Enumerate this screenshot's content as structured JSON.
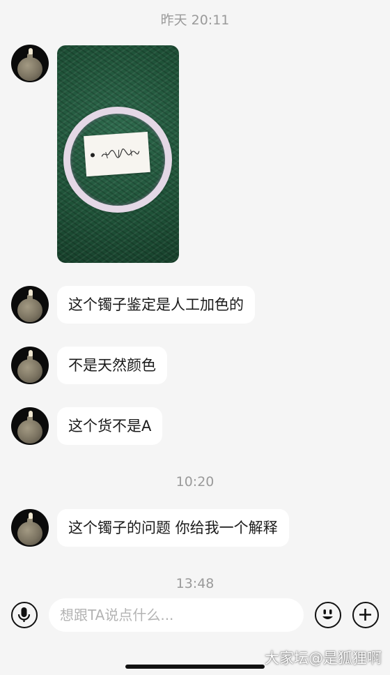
{
  "timestamps": [
    "昨天 20:11",
    "10:20",
    "13:48"
  ],
  "messages": [
    {
      "text": "这个镯子鉴定是人工加色的"
    },
    {
      "text": "不是天然颜色"
    },
    {
      "text": "这个货不是A"
    },
    {
      "text": "这个镯子的问题 你给我一个解释"
    }
  ],
  "photo_tag_text": "手写鉴定标签",
  "input": {
    "placeholder": "想跟TA说点什么..."
  },
  "icons": {
    "voice": "microphone-icon",
    "emoji": "smiley-icon",
    "more": "plus-icon"
  },
  "watermark": "大家坛@是狐狸啊",
  "colors": {
    "background": "#f5f5f5",
    "bubble": "#ffffff",
    "timestamp": "#9a9a9a",
    "mat": "#1f5238"
  }
}
